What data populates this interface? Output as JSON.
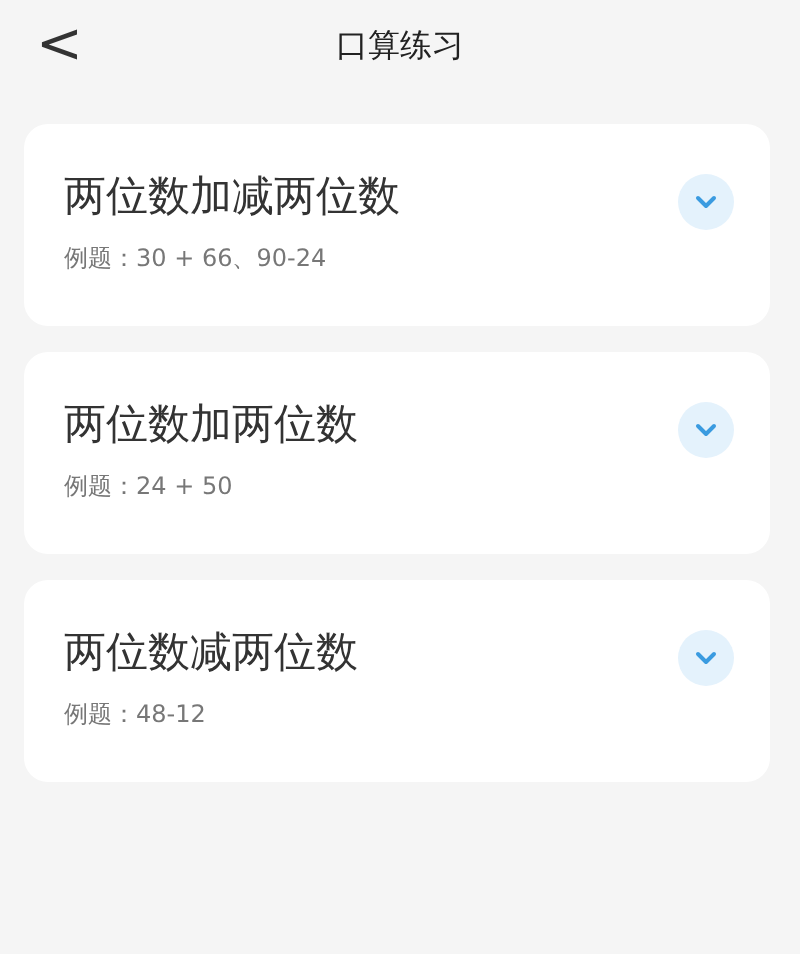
{
  "header": {
    "back": "<",
    "title": "口算练习"
  },
  "items": [
    {
      "title": "两位数加减两位数",
      "example": "例题：30 + 66、90-24",
      "expanded": false
    },
    {
      "title": "两位数加两位数",
      "example": "例题：24 + 50",
      "expanded": false
    },
    {
      "title": "两位数减两位数",
      "example": "例题：48-12",
      "expanded": false
    }
  ]
}
